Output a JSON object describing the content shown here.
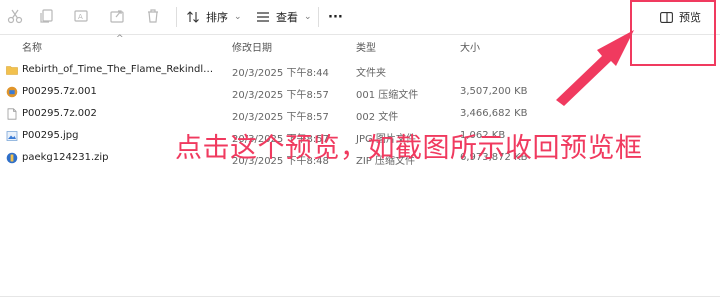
{
  "toolbar": {
    "sort_label": "排序",
    "view_label": "查看",
    "more_label": "···",
    "preview_label": "预览"
  },
  "columns": {
    "name": "名称",
    "date": "修改日期",
    "type": "类型",
    "size": "大小"
  },
  "files": [
    {
      "name": "Rebirth_of_Time_The_Flame_Rekindled_-_M...",
      "date": "20/3/2025 下午8:44",
      "type": "文件夹",
      "size": "",
      "icon": "folder-icon"
    },
    {
      "name": "P00295.7z.001",
      "date": "20/3/2025 下午8:57",
      "type": "001 压缩文件",
      "size": "3,507,200 KB",
      "icon": "archive-icon"
    },
    {
      "name": "P00295.7z.002",
      "date": "20/3/2025 下午8:57",
      "type": "002 文件",
      "size": "3,466,682 KB",
      "icon": "file-icon"
    },
    {
      "name": "P00295.jpg",
      "date": "20/3/2025 下午8:57",
      "type": "JPG 图片文件",
      "size": "1,062 KB",
      "icon": "image-icon"
    },
    {
      "name": "paekg124231.zip",
      "date": "20/3/2025 下午8:48",
      "type": "ZIP 压缩文件",
      "size": "6,973,872 KB",
      "icon": "zip-icon"
    }
  ],
  "annotation": {
    "text": "点击这个预览，如截图所示收回预览框",
    "color": "#f03a5f"
  },
  "colors": {
    "accent": "#f03a5f",
    "folder": "#f2c14e"
  }
}
